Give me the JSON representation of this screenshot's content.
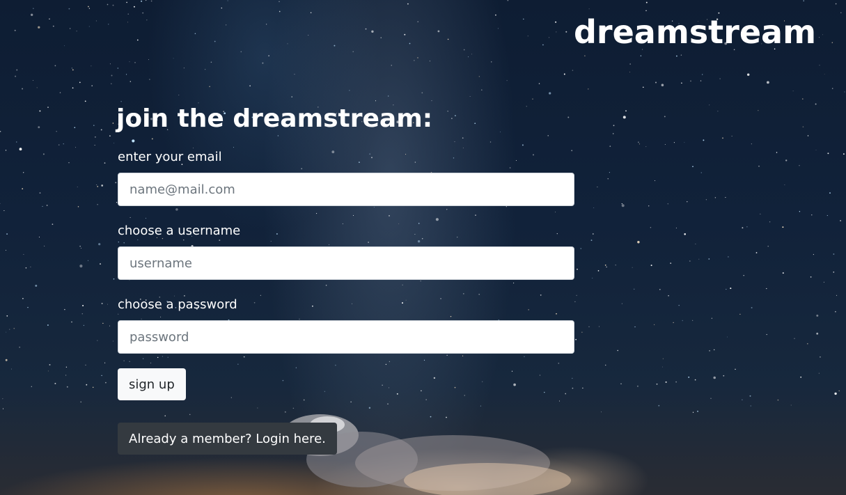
{
  "brand": {
    "name": "dreamstream"
  },
  "signup_form": {
    "title": "join the dreamstream:",
    "email": {
      "label": "enter your email",
      "placeholder": "name@mail.com",
      "value": ""
    },
    "username": {
      "label": "choose a username",
      "placeholder": "username",
      "value": ""
    },
    "password": {
      "label": "choose a password",
      "placeholder": "password",
      "value": ""
    },
    "submit_label": "sign up",
    "login_link_label": "Already a member? Login here."
  },
  "colors": {
    "sky_dark": "#0e1d33",
    "input_background": "#ffffff",
    "signup_button_background": "#f8f9fa",
    "login_button_background": "#343a40",
    "text_light": "#ffffff"
  }
}
